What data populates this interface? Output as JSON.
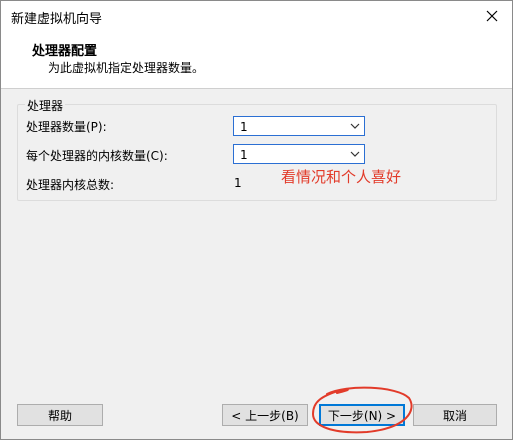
{
  "window": {
    "title": "新建虚拟机向导"
  },
  "header": {
    "title": "处理器配置",
    "subtitle": "为此虚拟机指定处理器数量。"
  },
  "group": {
    "label": "处理器",
    "processor_count_label": "处理器数量(P):",
    "processor_count_value": "1",
    "cores_per_processor_label": "每个处理器的内核数量(C):",
    "cores_per_processor_value": "1",
    "total_cores_label": "处理器内核总数:",
    "total_cores_value": "1"
  },
  "annotation": {
    "text": "看情况和个人喜好",
    "color": "#e23b2a"
  },
  "buttons": {
    "help": "帮助",
    "back": "< 上一步(B)",
    "next": "下一步(N) >",
    "cancel": "取消"
  },
  "icons": {
    "close": "close-icon",
    "dropdown": "chevron-down-icon"
  },
  "colors": {
    "accent": "#0078d7",
    "annotation": "#e23b2a"
  }
}
